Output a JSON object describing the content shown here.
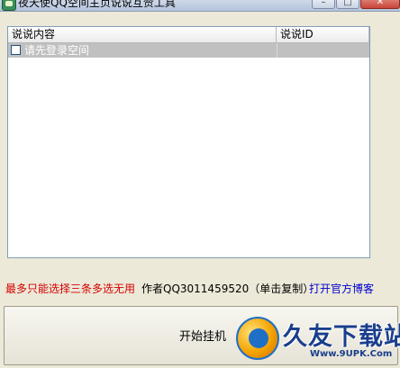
{
  "window": {
    "title": "夜天使QQ空间主页说说互赞工具",
    "buttons": [
      "–",
      "□",
      "✕"
    ]
  },
  "listview": {
    "columns": [
      "说说内容",
      "说说ID"
    ],
    "rows": [
      {
        "content": "请先登录空间",
        "id": "",
        "checked": false,
        "selected": true
      }
    ]
  },
  "footer": {
    "warning": "最多只能选择三条多选无用",
    "author": "作者QQ3011459520（单击复制）",
    "blog_link": "打开官方博客"
  },
  "start_button": {
    "label": "开始挂机"
  },
  "watermark": {
    "title": "久友下载站",
    "url": "Www.9UPK.Com"
  },
  "colors": {
    "warning": "#d40000",
    "link": "#0000cc",
    "selected_row": "#c0c0c0"
  }
}
